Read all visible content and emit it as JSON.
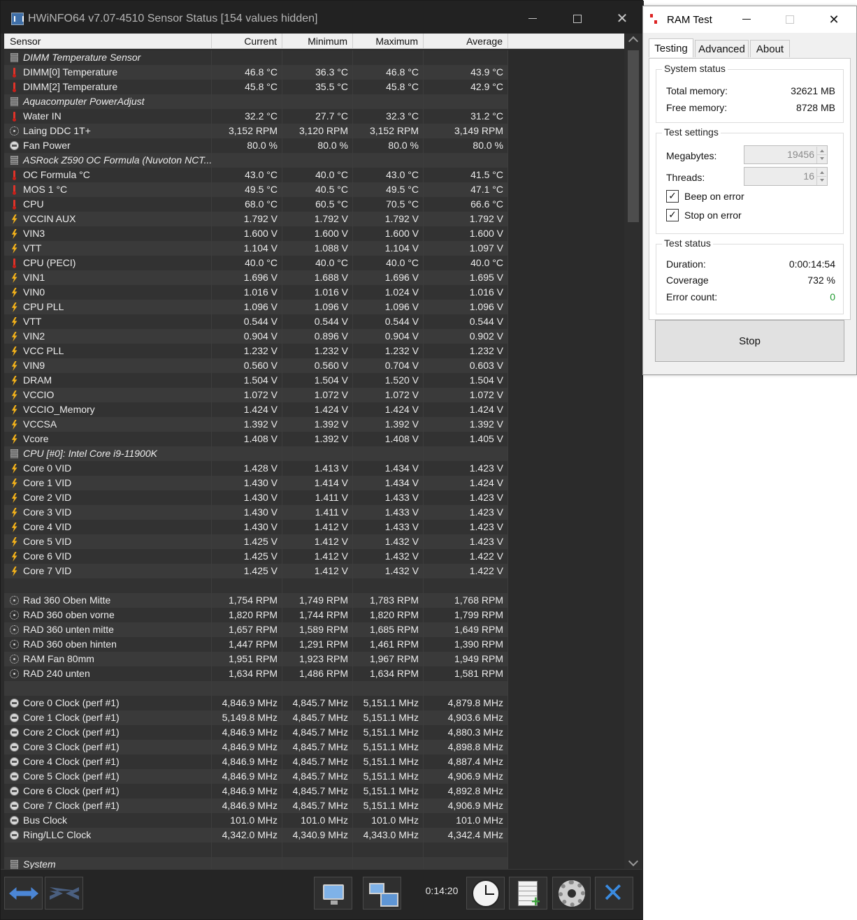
{
  "hwinfo": {
    "title": "HWiNFO64 v7.07-4510 Sensor Status [154 values hidden]",
    "columns": [
      "Sensor",
      "Current",
      "Minimum",
      "Maximum",
      "Average"
    ],
    "rows": [
      {
        "type": "group",
        "icon": "chip-icon",
        "name": "DIMM Temperature Sensor"
      },
      {
        "type": "sensor",
        "icon": "thermometer-icon",
        "name": "DIMM[0] Temperature",
        "v": [
          "46.8 °C",
          "36.3 °C",
          "46.8 °C",
          "43.9 °C"
        ]
      },
      {
        "type": "sensor",
        "icon": "thermometer-icon",
        "name": "DIMM[2] Temperature",
        "v": [
          "45.8 °C",
          "35.5 °C",
          "45.8 °C",
          "42.9 °C"
        ]
      },
      {
        "type": "group",
        "icon": "chip-icon",
        "name": "Aquacomputer PowerAdjust"
      },
      {
        "type": "sensor",
        "icon": "thermometer-icon",
        "name": "Water IN",
        "v": [
          "32.2 °C",
          "27.7 °C",
          "32.3 °C",
          "31.2 °C"
        ]
      },
      {
        "type": "sensor",
        "icon": "fan-icon",
        "name": "Laing DDC 1T+",
        "v": [
          "3,152 RPM",
          "3,120 RPM",
          "3,152 RPM",
          "3,149 RPM"
        ]
      },
      {
        "type": "sensor",
        "icon": "gauge-icon",
        "name": "Fan Power",
        "v": [
          "80.0 %",
          "80.0 %",
          "80.0 %",
          "80.0 %"
        ]
      },
      {
        "type": "group",
        "icon": "chip-icon",
        "name": "ASRock Z590 OC Formula (Nuvoton NCT..."
      },
      {
        "type": "sensor",
        "icon": "thermometer-icon",
        "name": "OC Formula °C",
        "v": [
          "43.0 °C",
          "40.0 °C",
          "43.0 °C",
          "41.5 °C"
        ]
      },
      {
        "type": "sensor",
        "icon": "thermometer-icon",
        "name": "MOS 1 °C",
        "v": [
          "49.5 °C",
          "40.5 °C",
          "49.5 °C",
          "47.1 °C"
        ]
      },
      {
        "type": "sensor",
        "icon": "thermometer-icon",
        "name": "CPU",
        "v": [
          "68.0 °C",
          "60.5 °C",
          "70.5 °C",
          "66.6 °C"
        ]
      },
      {
        "type": "sensor",
        "icon": "voltage-icon",
        "name": "VCCIN AUX",
        "v": [
          "1.792 V",
          "1.792 V",
          "1.792 V",
          "1.792 V"
        ]
      },
      {
        "type": "sensor",
        "icon": "voltage-icon",
        "name": "VIN3",
        "v": [
          "1.600 V",
          "1.600 V",
          "1.600 V",
          "1.600 V"
        ]
      },
      {
        "type": "sensor",
        "icon": "voltage-icon",
        "name": "VTT",
        "v": [
          "1.104 V",
          "1.088 V",
          "1.104 V",
          "1.097 V"
        ]
      },
      {
        "type": "sensor",
        "icon": "thermometer-icon",
        "name": "CPU (PECI)",
        "v": [
          "40.0 °C",
          "40.0 °C",
          "40.0 °C",
          "40.0 °C"
        ]
      },
      {
        "type": "sensor",
        "icon": "voltage-icon",
        "name": "VIN1",
        "v": [
          "1.696 V",
          "1.688 V",
          "1.696 V",
          "1.695 V"
        ]
      },
      {
        "type": "sensor",
        "icon": "voltage-icon",
        "name": "VIN0",
        "v": [
          "1.016 V",
          "1.016 V",
          "1.024 V",
          "1.016 V"
        ]
      },
      {
        "type": "sensor",
        "icon": "voltage-icon",
        "name": "CPU PLL",
        "v": [
          "1.096 V",
          "1.096 V",
          "1.096 V",
          "1.096 V"
        ]
      },
      {
        "type": "sensor",
        "icon": "voltage-icon",
        "name": "VTT",
        "v": [
          "0.544 V",
          "0.544 V",
          "0.544 V",
          "0.544 V"
        ]
      },
      {
        "type": "sensor",
        "icon": "voltage-icon",
        "name": "VIN2",
        "v": [
          "0.904 V",
          "0.896 V",
          "0.904 V",
          "0.902 V"
        ]
      },
      {
        "type": "sensor",
        "icon": "voltage-icon",
        "name": "VCC PLL",
        "v": [
          "1.232 V",
          "1.232 V",
          "1.232 V",
          "1.232 V"
        ]
      },
      {
        "type": "sensor",
        "icon": "voltage-icon",
        "name": "VIN9",
        "v": [
          "0.560 V",
          "0.560 V",
          "0.704 V",
          "0.603 V"
        ]
      },
      {
        "type": "sensor",
        "icon": "voltage-icon",
        "name": "DRAM",
        "v": [
          "1.504 V",
          "1.504 V",
          "1.520 V",
          "1.504 V"
        ]
      },
      {
        "type": "sensor",
        "icon": "voltage-icon",
        "name": "VCCIO",
        "v": [
          "1.072 V",
          "1.072 V",
          "1.072 V",
          "1.072 V"
        ]
      },
      {
        "type": "sensor",
        "icon": "voltage-icon",
        "name": "VCCIO_Memory",
        "v": [
          "1.424 V",
          "1.424 V",
          "1.424 V",
          "1.424 V"
        ]
      },
      {
        "type": "sensor",
        "icon": "voltage-icon",
        "name": "VCCSA",
        "v": [
          "1.392 V",
          "1.392 V",
          "1.392 V",
          "1.392 V"
        ]
      },
      {
        "type": "sensor",
        "icon": "voltage-icon",
        "name": "Vcore",
        "v": [
          "1.408 V",
          "1.392 V",
          "1.408 V",
          "1.405 V"
        ]
      },
      {
        "type": "group",
        "icon": "chip-icon",
        "name": "CPU [#0]: Intel Core i9-11900K"
      },
      {
        "type": "sensor",
        "icon": "voltage-icon",
        "name": "Core 0 VID",
        "v": [
          "1.428 V",
          "1.413 V",
          "1.434 V",
          "1.423 V"
        ]
      },
      {
        "type": "sensor",
        "icon": "voltage-icon",
        "name": "Core 1 VID",
        "v": [
          "1.430 V",
          "1.414 V",
          "1.434 V",
          "1.424 V"
        ]
      },
      {
        "type": "sensor",
        "icon": "voltage-icon",
        "name": "Core 2 VID",
        "v": [
          "1.430 V",
          "1.411 V",
          "1.433 V",
          "1.423 V"
        ]
      },
      {
        "type": "sensor",
        "icon": "voltage-icon",
        "name": "Core 3 VID",
        "v": [
          "1.430 V",
          "1.411 V",
          "1.433 V",
          "1.423 V"
        ]
      },
      {
        "type": "sensor",
        "icon": "voltage-icon",
        "name": "Core 4 VID",
        "v": [
          "1.430 V",
          "1.412 V",
          "1.433 V",
          "1.423 V"
        ]
      },
      {
        "type": "sensor",
        "icon": "voltage-icon",
        "name": "Core 5 VID",
        "v": [
          "1.425 V",
          "1.412 V",
          "1.432 V",
          "1.423 V"
        ]
      },
      {
        "type": "sensor",
        "icon": "voltage-icon",
        "name": "Core 6 VID",
        "v": [
          "1.425 V",
          "1.412 V",
          "1.432 V",
          "1.422 V"
        ]
      },
      {
        "type": "sensor",
        "icon": "voltage-icon",
        "name": "Core 7 VID",
        "v": [
          "1.425 V",
          "1.412 V",
          "1.432 V",
          "1.422 V"
        ]
      },
      {
        "type": "blank"
      },
      {
        "type": "sensor",
        "icon": "fan-icon",
        "name": "Rad 360 Oben Mitte",
        "v": [
          "1,754 RPM",
          "1,749 RPM",
          "1,783 RPM",
          "1,768 RPM"
        ]
      },
      {
        "type": "sensor",
        "icon": "fan-icon",
        "name": "RAD 360 oben vorne",
        "v": [
          "1,820 RPM",
          "1,744 RPM",
          "1,820 RPM",
          "1,799 RPM"
        ]
      },
      {
        "type": "sensor",
        "icon": "fan-icon",
        "name": "RAD 360 unten mitte",
        "v": [
          "1,657 RPM",
          "1,589 RPM",
          "1,685 RPM",
          "1,649 RPM"
        ]
      },
      {
        "type": "sensor",
        "icon": "fan-icon",
        "name": "RAD 360 oben hinten",
        "v": [
          "1,447 RPM",
          "1,291 RPM",
          "1,461 RPM",
          "1,390 RPM"
        ]
      },
      {
        "type": "sensor",
        "icon": "fan-icon",
        "name": "RAM Fan 80mm",
        "v": [
          "1,951 RPM",
          "1,923 RPM",
          "1,967 RPM",
          "1,949 RPM"
        ]
      },
      {
        "type": "sensor",
        "icon": "fan-icon",
        "name": "RAD 240 unten",
        "v": [
          "1,634 RPM",
          "1,486 RPM",
          "1,634 RPM",
          "1,581 RPM"
        ]
      },
      {
        "type": "blank"
      },
      {
        "type": "sensor",
        "icon": "gauge-icon",
        "name": "Core 0 Clock (perf #1)",
        "v": [
          "4,846.9 MHz",
          "4,845.7 MHz",
          "5,151.1 MHz",
          "4,879.8 MHz"
        ]
      },
      {
        "type": "sensor",
        "icon": "gauge-icon",
        "name": "Core 1 Clock (perf #1)",
        "v": [
          "5,149.8 MHz",
          "4,845.7 MHz",
          "5,151.1 MHz",
          "4,903.6 MHz"
        ]
      },
      {
        "type": "sensor",
        "icon": "gauge-icon",
        "name": "Core 2 Clock (perf #1)",
        "v": [
          "4,846.9 MHz",
          "4,845.7 MHz",
          "5,151.1 MHz",
          "4,880.3 MHz"
        ]
      },
      {
        "type": "sensor",
        "icon": "gauge-icon",
        "name": "Core 3 Clock (perf #1)",
        "v": [
          "4,846.9 MHz",
          "4,845.7 MHz",
          "5,151.1 MHz",
          "4,898.8 MHz"
        ]
      },
      {
        "type": "sensor",
        "icon": "gauge-icon",
        "name": "Core 4 Clock (perf #1)",
        "v": [
          "4,846.9 MHz",
          "4,845.7 MHz",
          "5,151.1 MHz",
          "4,887.4 MHz"
        ]
      },
      {
        "type": "sensor",
        "icon": "gauge-icon",
        "name": "Core 5 Clock (perf #1)",
        "v": [
          "4,846.9 MHz",
          "4,845.7 MHz",
          "5,151.1 MHz",
          "4,906.9 MHz"
        ]
      },
      {
        "type": "sensor",
        "icon": "gauge-icon",
        "name": "Core 6 Clock (perf #1)",
        "v": [
          "4,846.9 MHz",
          "4,845.7 MHz",
          "5,151.1 MHz",
          "4,892.8 MHz"
        ]
      },
      {
        "type": "sensor",
        "icon": "gauge-icon",
        "name": "Core 7 Clock (perf #1)",
        "v": [
          "4,846.9 MHz",
          "4,845.7 MHz",
          "5,151.1 MHz",
          "4,906.9 MHz"
        ]
      },
      {
        "type": "sensor",
        "icon": "gauge-icon",
        "name": "Bus Clock",
        "v": [
          "101.0 MHz",
          "101.0 MHz",
          "101.0 MHz",
          "101.0 MHz"
        ]
      },
      {
        "type": "sensor",
        "icon": "gauge-icon",
        "name": "Ring/LLC Clock",
        "v": [
          "4,342.0 MHz",
          "4,340.9 MHz",
          "4,343.0 MHz",
          "4,342.4 MHz"
        ]
      },
      {
        "type": "blank"
      },
      {
        "type": "group",
        "icon": "chip-icon",
        "name": "System"
      }
    ],
    "toolbar": {
      "elapsed": "0:14:20"
    }
  },
  "ramtest": {
    "title": "RAM Test",
    "tabs": [
      "Testing",
      "Advanced",
      "About"
    ],
    "system_status": {
      "title": "System status",
      "total_label": "Total memory:",
      "total_value": "32621 MB",
      "free_label": "Free memory:",
      "free_value": "8728 MB"
    },
    "test_settings": {
      "title": "Test settings",
      "megabytes_label": "Megabytes:",
      "megabytes_value": "19456",
      "threads_label": "Threads:",
      "threads_value": "16",
      "beep_label": "Beep on error",
      "beep_checked": "✓",
      "stop_label": "Stop on error",
      "stop_checked": "✓"
    },
    "test_status": {
      "title": "Test status",
      "duration_label": "Duration:",
      "duration_value": "0:00:14:54",
      "coverage_label": "Coverage",
      "coverage_value": "732 %",
      "errors_label": "Error count:",
      "errors_value": "0"
    },
    "stop_button": "Stop"
  }
}
